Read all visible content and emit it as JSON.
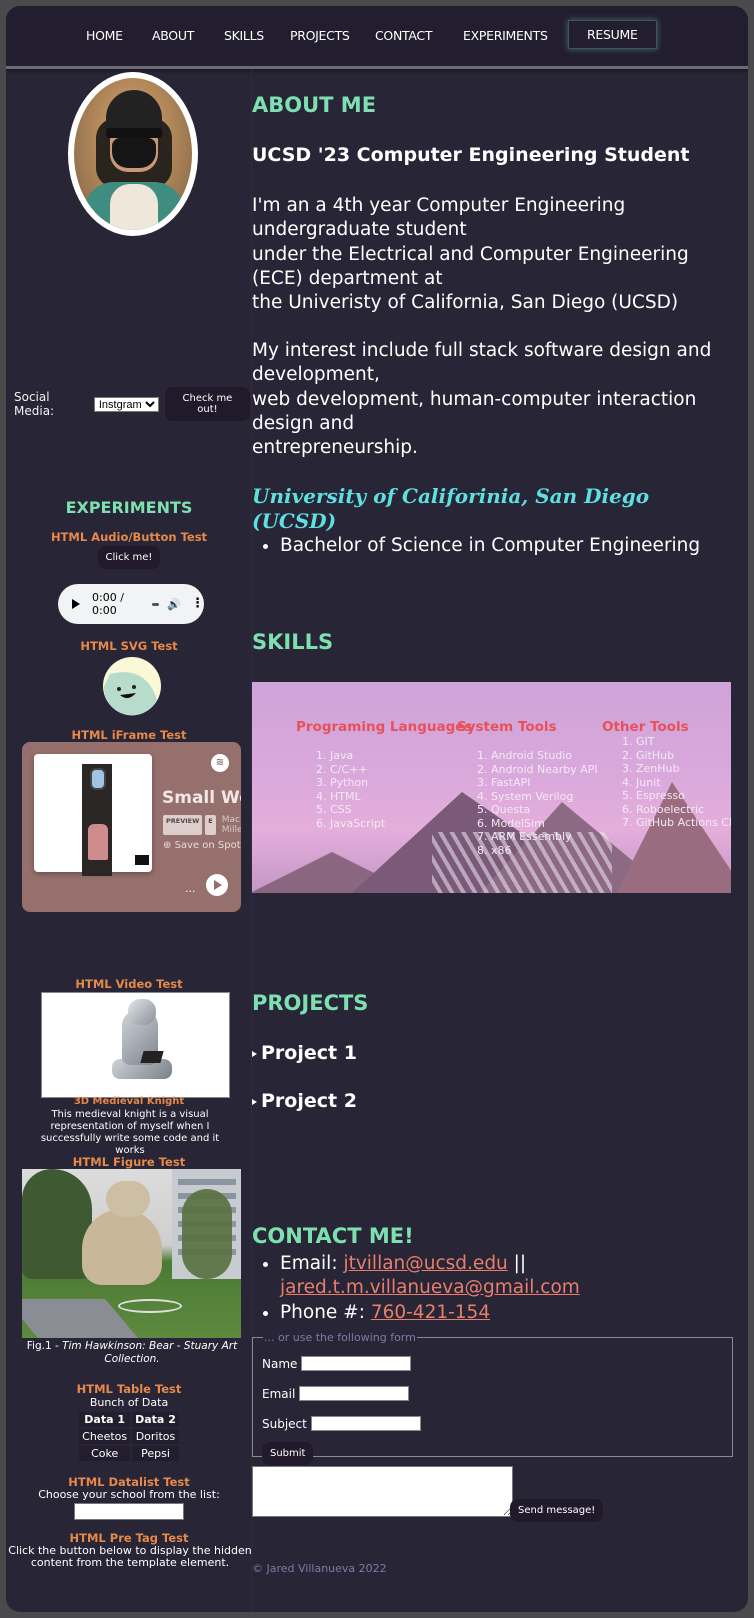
{
  "nav": {
    "items": [
      "HOME",
      "ABOUT",
      "SKILLS",
      "PROJECTS",
      "CONTACT",
      "EXPERIMENTS"
    ],
    "resume": "RESUME"
  },
  "sidebar": {
    "social_label": "Social Media:",
    "social_selected": "Instgram",
    "check_button": "Check me out!",
    "experiments_title": "EXPERIMENTS",
    "audio_test_title": "HTML Audio/Button Test",
    "click_button": "Click me!",
    "audio": {
      "time": "0:00 / 0:00"
    },
    "svg_test_title": "HTML SVG Test",
    "iframe_test_title": "HTML iFrame Test",
    "spotify": {
      "title": "Small Worlds",
      "preview_badge": "PREVIEW",
      "explicit_badge": "E",
      "artist": "Mac Miller",
      "save": "Save on Spotify",
      "more": "..."
    },
    "video_test_title": "HTML Video Test",
    "video_caption_title": "3D Medieval Knight",
    "video_caption_text": "This medieval knight is a visual representation of myself when I successfully write some code and it works",
    "figure_test_title": "HTML Figure Test",
    "figure_caption_prefix": "Fig.1 - ",
    "figure_caption_italic": "Tim Hawkinson: Bear - Stuary Art Collection.",
    "table_test_title": "HTML Table Test",
    "table": {
      "caption": "Bunch of Data",
      "headers": [
        "Data 1",
        "Data 2"
      ],
      "rows": [
        [
          "Cheetos",
          "Doritos"
        ],
        [
          "Coke",
          "Pepsi"
        ]
      ]
    },
    "datalist_test_title": "HTML Datalist Test",
    "datalist_label": "Choose your school from the list:",
    "pre_test_title": "HTML Pre Tag Test",
    "pre_test_text": "Click the button below to display the hidden content from the template element."
  },
  "about": {
    "heading": "ABOUT ME",
    "subtitle": "UCSD '23 Computer Engineering Student",
    "para1": "I'm an a 4th year Computer Engineering undergraduate student\nunder the Electrical and Computer Engineering (ECE) department at\nthe Univeristy of California, San Diego (UCSD)",
    "para2": "My interest include full stack software design and development,\nweb development, human-computer interaction design and\nentrepreneurship.",
    "university": "University of Califorinia, San Diego (UCSD)",
    "degree": "Bachelor of Science in Computer Engineering"
  },
  "skills": {
    "heading": "SKILLS",
    "columns": [
      {
        "title": "Programing Languages",
        "items": [
          "Java",
          "C/C++",
          "Python",
          "HTML",
          "CSS",
          "JavaScript"
        ]
      },
      {
        "title": "System Tools",
        "items": [
          "Android Studio",
          "Android Nearby API",
          "FastAPI",
          "System Verilog",
          "Questa",
          "ModelSim",
          "ARM Essembly",
          "x86"
        ]
      },
      {
        "title": "Other Tools",
        "items": [
          "GIT",
          "GitHub",
          "ZenHub",
          "Junit",
          "Espresso",
          "Roboelectric",
          "GitHub Actions CI"
        ]
      }
    ]
  },
  "projects": {
    "heading": "PROJECTS",
    "items": [
      "Project 1",
      "Project 2"
    ]
  },
  "contact": {
    "heading": "CONTACT ME!",
    "email_label": "Email: ",
    "email1": "jtvillan@ucsd.edu",
    "separator": " ||",
    "email2": "jared.t.m.villanueva@gmail.com",
    "phone_label": "Phone #: ",
    "phone": "760-421-154",
    "form_legend": "... or use the following form",
    "name_label": "Name",
    "email_field_label": "Email",
    "subject_label": "Subject",
    "submit": "Submit",
    "send": "Send message!",
    "footer": "© Jared Villanueva 2022"
  },
  "colors": {
    "background": "#272536",
    "nav": "#221e30",
    "heading_accent": "#7ee0b0",
    "test_title": "#e6894a",
    "university": "#5ee0e0",
    "link": "#e87e6c",
    "skill_title": "#e8505a"
  }
}
